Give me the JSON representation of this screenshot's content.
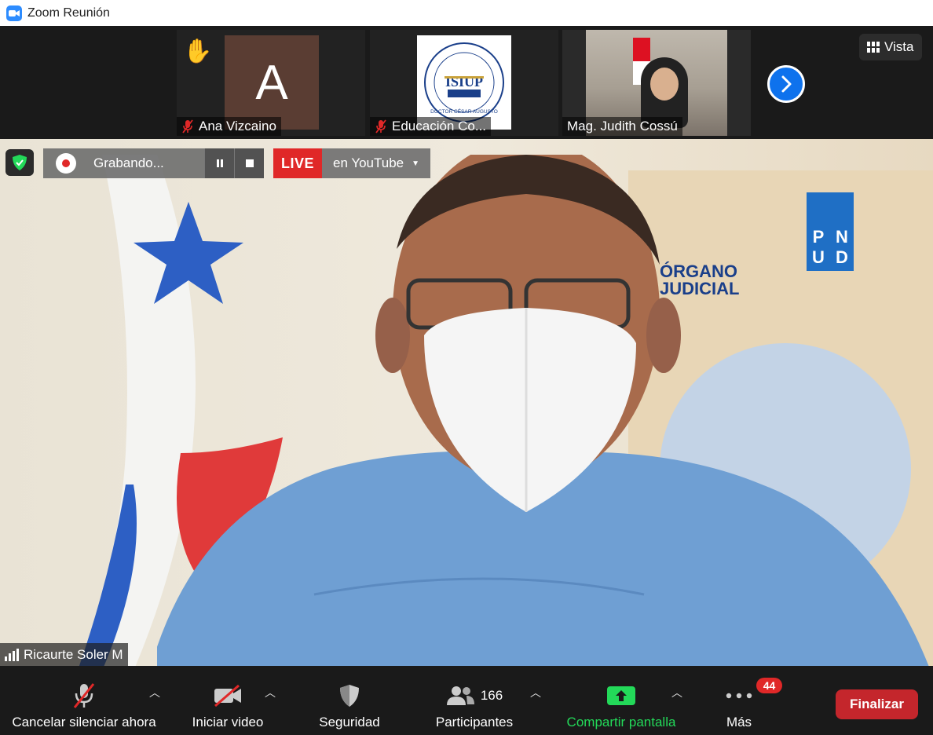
{
  "window": {
    "title": "Zoom Reunión"
  },
  "thumbnails": [
    {
      "name": "Ana Vizcaino",
      "avatar_letter": "A",
      "muted": true,
      "hand_raised": true
    },
    {
      "name": "Educación Co...",
      "muted": true,
      "logo_text": "ISIUP",
      "logo_caption": "DOCTOR CÉSAR AUGUSTO"
    },
    {
      "name": "Mag. Judith Cossú",
      "muted": false
    }
  ],
  "view_button": {
    "label": "Vista"
  },
  "recording": {
    "label": "Grabando..."
  },
  "live": {
    "tag": "LIVE",
    "destination": "en YouTube"
  },
  "speaker": {
    "name": "Ricaurte Soler M"
  },
  "background_texts": {
    "pnud": [
      "P",
      "N",
      "U",
      "D"
    ],
    "organo": [
      "ÓRGANO",
      "JUDICIAL"
    ]
  },
  "toolbar": {
    "mute_label": "Cancelar silenciar ahora",
    "video_label": "Iniciar video",
    "security_label": "Seguridad",
    "participants_label": "Participantes",
    "participants_count": "166",
    "share_label": "Compartir pantalla",
    "more_label": "Más",
    "more_badge": "44",
    "end_label": "Finalizar"
  },
  "colors": {
    "accent": "#2d8cff",
    "share_green": "#23d959",
    "end_red": "#c4262c",
    "live_red": "#e02828"
  }
}
